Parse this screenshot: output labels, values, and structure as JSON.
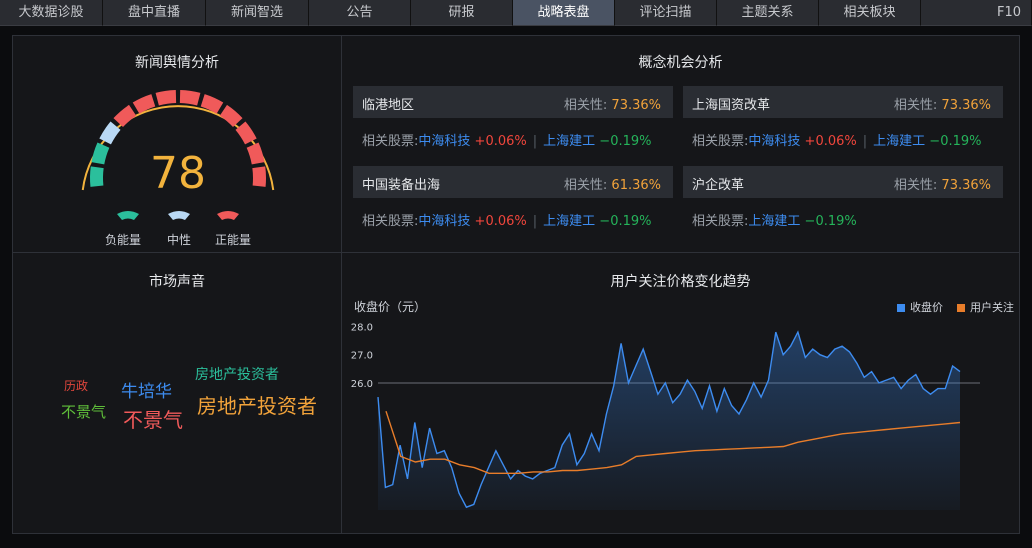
{
  "tabs": [
    "大数据诊股",
    "盘中直播",
    "新闻智选",
    "公告",
    "研报",
    "战略表盘",
    "评论扫描",
    "主题关系",
    "相关板块",
    "F10"
  ],
  "active_tab": "战略表盘",
  "sentiment": {
    "title": "新闻舆情分析",
    "score": "78",
    "labels": {
      "negative": "负能量",
      "neutral": "中性",
      "positive": "正能量"
    },
    "colors": {
      "negative": "#2bbf9c",
      "neutral": "#b9d9f5",
      "positive": "#f05a5a",
      "ring": "#f2b33d"
    }
  },
  "concepts": {
    "title": "概念机会分析",
    "relevance_label": "相关性:",
    "stocks_label": "相关股票:",
    "cards": [
      {
        "name": "临港地区",
        "relevance": "73.36%",
        "stocks": [
          {
            "name": "中海科技",
            "change": "+0.06%"
          },
          {
            "name": "上海建工",
            "change": "−0.19%"
          }
        ]
      },
      {
        "name": "上海国资改革",
        "relevance": "73.36%",
        "stocks": [
          {
            "name": "中海科技",
            "change": "+0.06%"
          },
          {
            "name": "上海建工",
            "change": "−0.19%"
          }
        ]
      },
      {
        "name": "中国装备出海",
        "relevance": "61.36%",
        "stocks": [
          {
            "name": "中海科技",
            "change": "+0.06%"
          },
          {
            "name": "上海建工",
            "change": "−0.19%"
          }
        ]
      },
      {
        "name": "沪企改革",
        "relevance": "73.36%",
        "stocks": [
          {
            "name": "上海建工",
            "change": "−0.19%"
          }
        ]
      }
    ]
  },
  "market_voice": {
    "title": "市场声音",
    "words": [
      {
        "text": "房地产投资者",
        "color": "#2bbf9c",
        "size": "small"
      },
      {
        "text": "历政",
        "color": "#e0463c",
        "size": "tiny"
      },
      {
        "text": "牛培华",
        "color": "#3d8cf0",
        "size": "medium"
      },
      {
        "text": "不景气",
        "color": "#5fbf3a",
        "size": "small"
      },
      {
        "text": "不景气",
        "color": "#f05a5a",
        "size": "large"
      },
      {
        "text": "房地产投资者",
        "color": "#f2a33a",
        "size": "large"
      }
    ]
  },
  "trend": {
    "title": "用户关注价格变化趋势",
    "ylabel": "收盘价（元）",
    "legend": [
      "收盘价",
      "用户关注"
    ]
  },
  "chart_data": {
    "type": "line",
    "title": "用户关注价格变化趋势",
    "ylabel": "收盘价（元）",
    "yticks": [
      "28.0",
      "27.0",
      "26.0"
    ],
    "ylim": [
      21.5,
      28.3
    ],
    "series": [
      {
        "name": "收盘价",
        "color": "#3d8cf0",
        "values": [
          25.5,
          22.3,
          22.4,
          23.8,
          22.6,
          24.6,
          23.0,
          24.4,
          23.5,
          23.6,
          23.0,
          22.1,
          21.6,
          21.7,
          22.4,
          23.0,
          23.6,
          23.1,
          22.6,
          22.9,
          22.7,
          22.6,
          22.8,
          22.9,
          23.0,
          23.8,
          24.2,
          23.1,
          23.5,
          24.2,
          23.6,
          24.9,
          25.9,
          27.4,
          26.0,
          26.6,
          27.2,
          26.4,
          25.6,
          26.0,
          25.3,
          25.6,
          26.1,
          25.7,
          25.1,
          25.9,
          25.0,
          25.8,
          25.2,
          24.9,
          25.4,
          26.0,
          25.5,
          26.1,
          27.8,
          27.0,
          27.3,
          27.8,
          26.9,
          27.2,
          27.0,
          26.9,
          27.2,
          27.3,
          27.1,
          26.7,
          26.2,
          26.4,
          26.0,
          26.1,
          26.2,
          25.8,
          26.1,
          26.3,
          25.8,
          25.6,
          25.8,
          25.8,
          26.6,
          26.4
        ]
      },
      {
        "name": "用户关注",
        "color": "#e87d2a",
        "values": [
          25.0,
          23.4,
          23.2,
          23.3,
          23.3,
          23.1,
          23.0,
          22.8,
          22.8,
          22.8,
          22.85,
          22.85,
          22.9,
          22.9,
          22.95,
          23.0,
          23.1,
          23.4,
          23.45,
          23.5,
          23.55,
          23.6,
          23.62,
          23.65,
          23.67,
          23.7,
          23.72,
          23.75,
          23.9,
          24.0,
          24.1,
          24.2,
          24.25,
          24.3,
          24.35,
          24.4,
          24.45,
          24.5,
          24.55,
          24.6
        ]
      }
    ]
  }
}
